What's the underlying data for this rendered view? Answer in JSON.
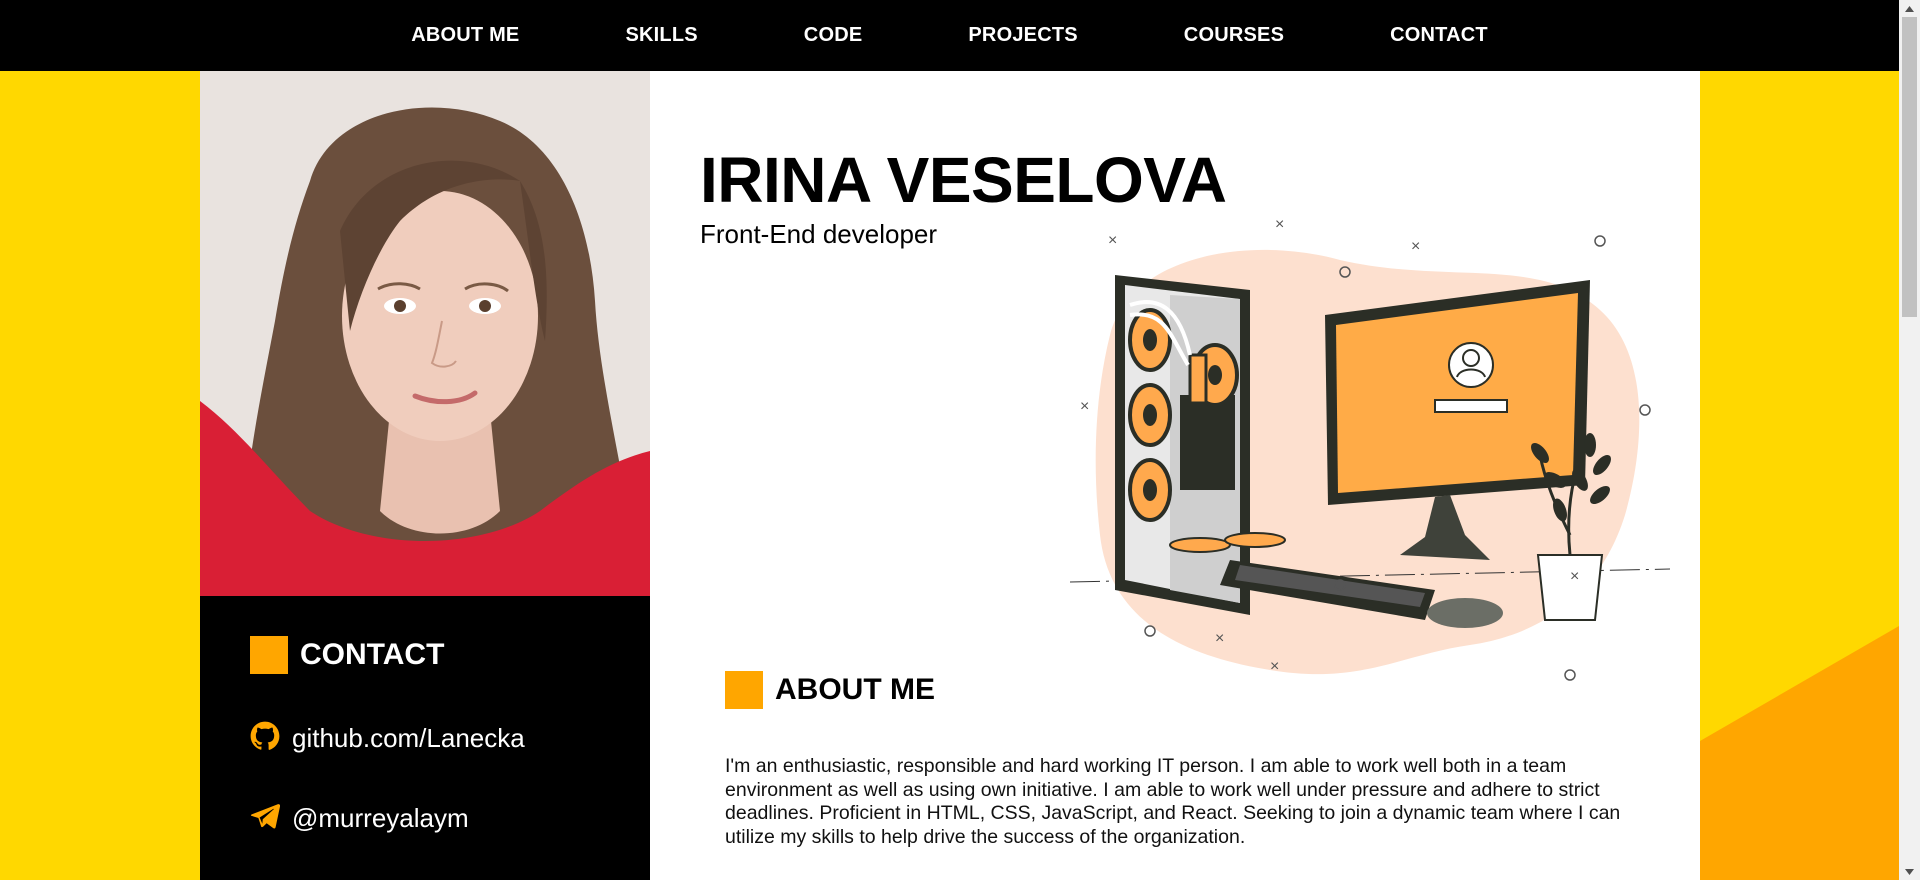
{
  "nav": {
    "items": [
      "ABOUT ME",
      "SKILLS",
      "CODE",
      "PROJECTS",
      "COURSES",
      "CONTACT"
    ]
  },
  "profile": {
    "name": "IRINA VESELOVA",
    "role": "Front-End developer"
  },
  "contact": {
    "title": "CONTACT",
    "github": "github.com/Lanecka",
    "telegram": "@murreyalaym"
  },
  "about": {
    "title": "ABOUT ME",
    "text": "I'm an enthusiastic, responsible and hard working IT person. I am able to work well both in a team environment as well as using own initiative. I am able to work well under pressure and adhere to strict deadlines. Proficient in HTML, CSS, JavaScript, and React. Seeking to join a dynamic team where I can utilize my skills to help drive the success of the organization."
  },
  "icons": {
    "github": "github-icon",
    "telegram": "telegram-icon"
  },
  "colors": {
    "background": "#ffd800",
    "accent": "#ffa600",
    "nav": "#000000",
    "panel": "#ffffff"
  }
}
